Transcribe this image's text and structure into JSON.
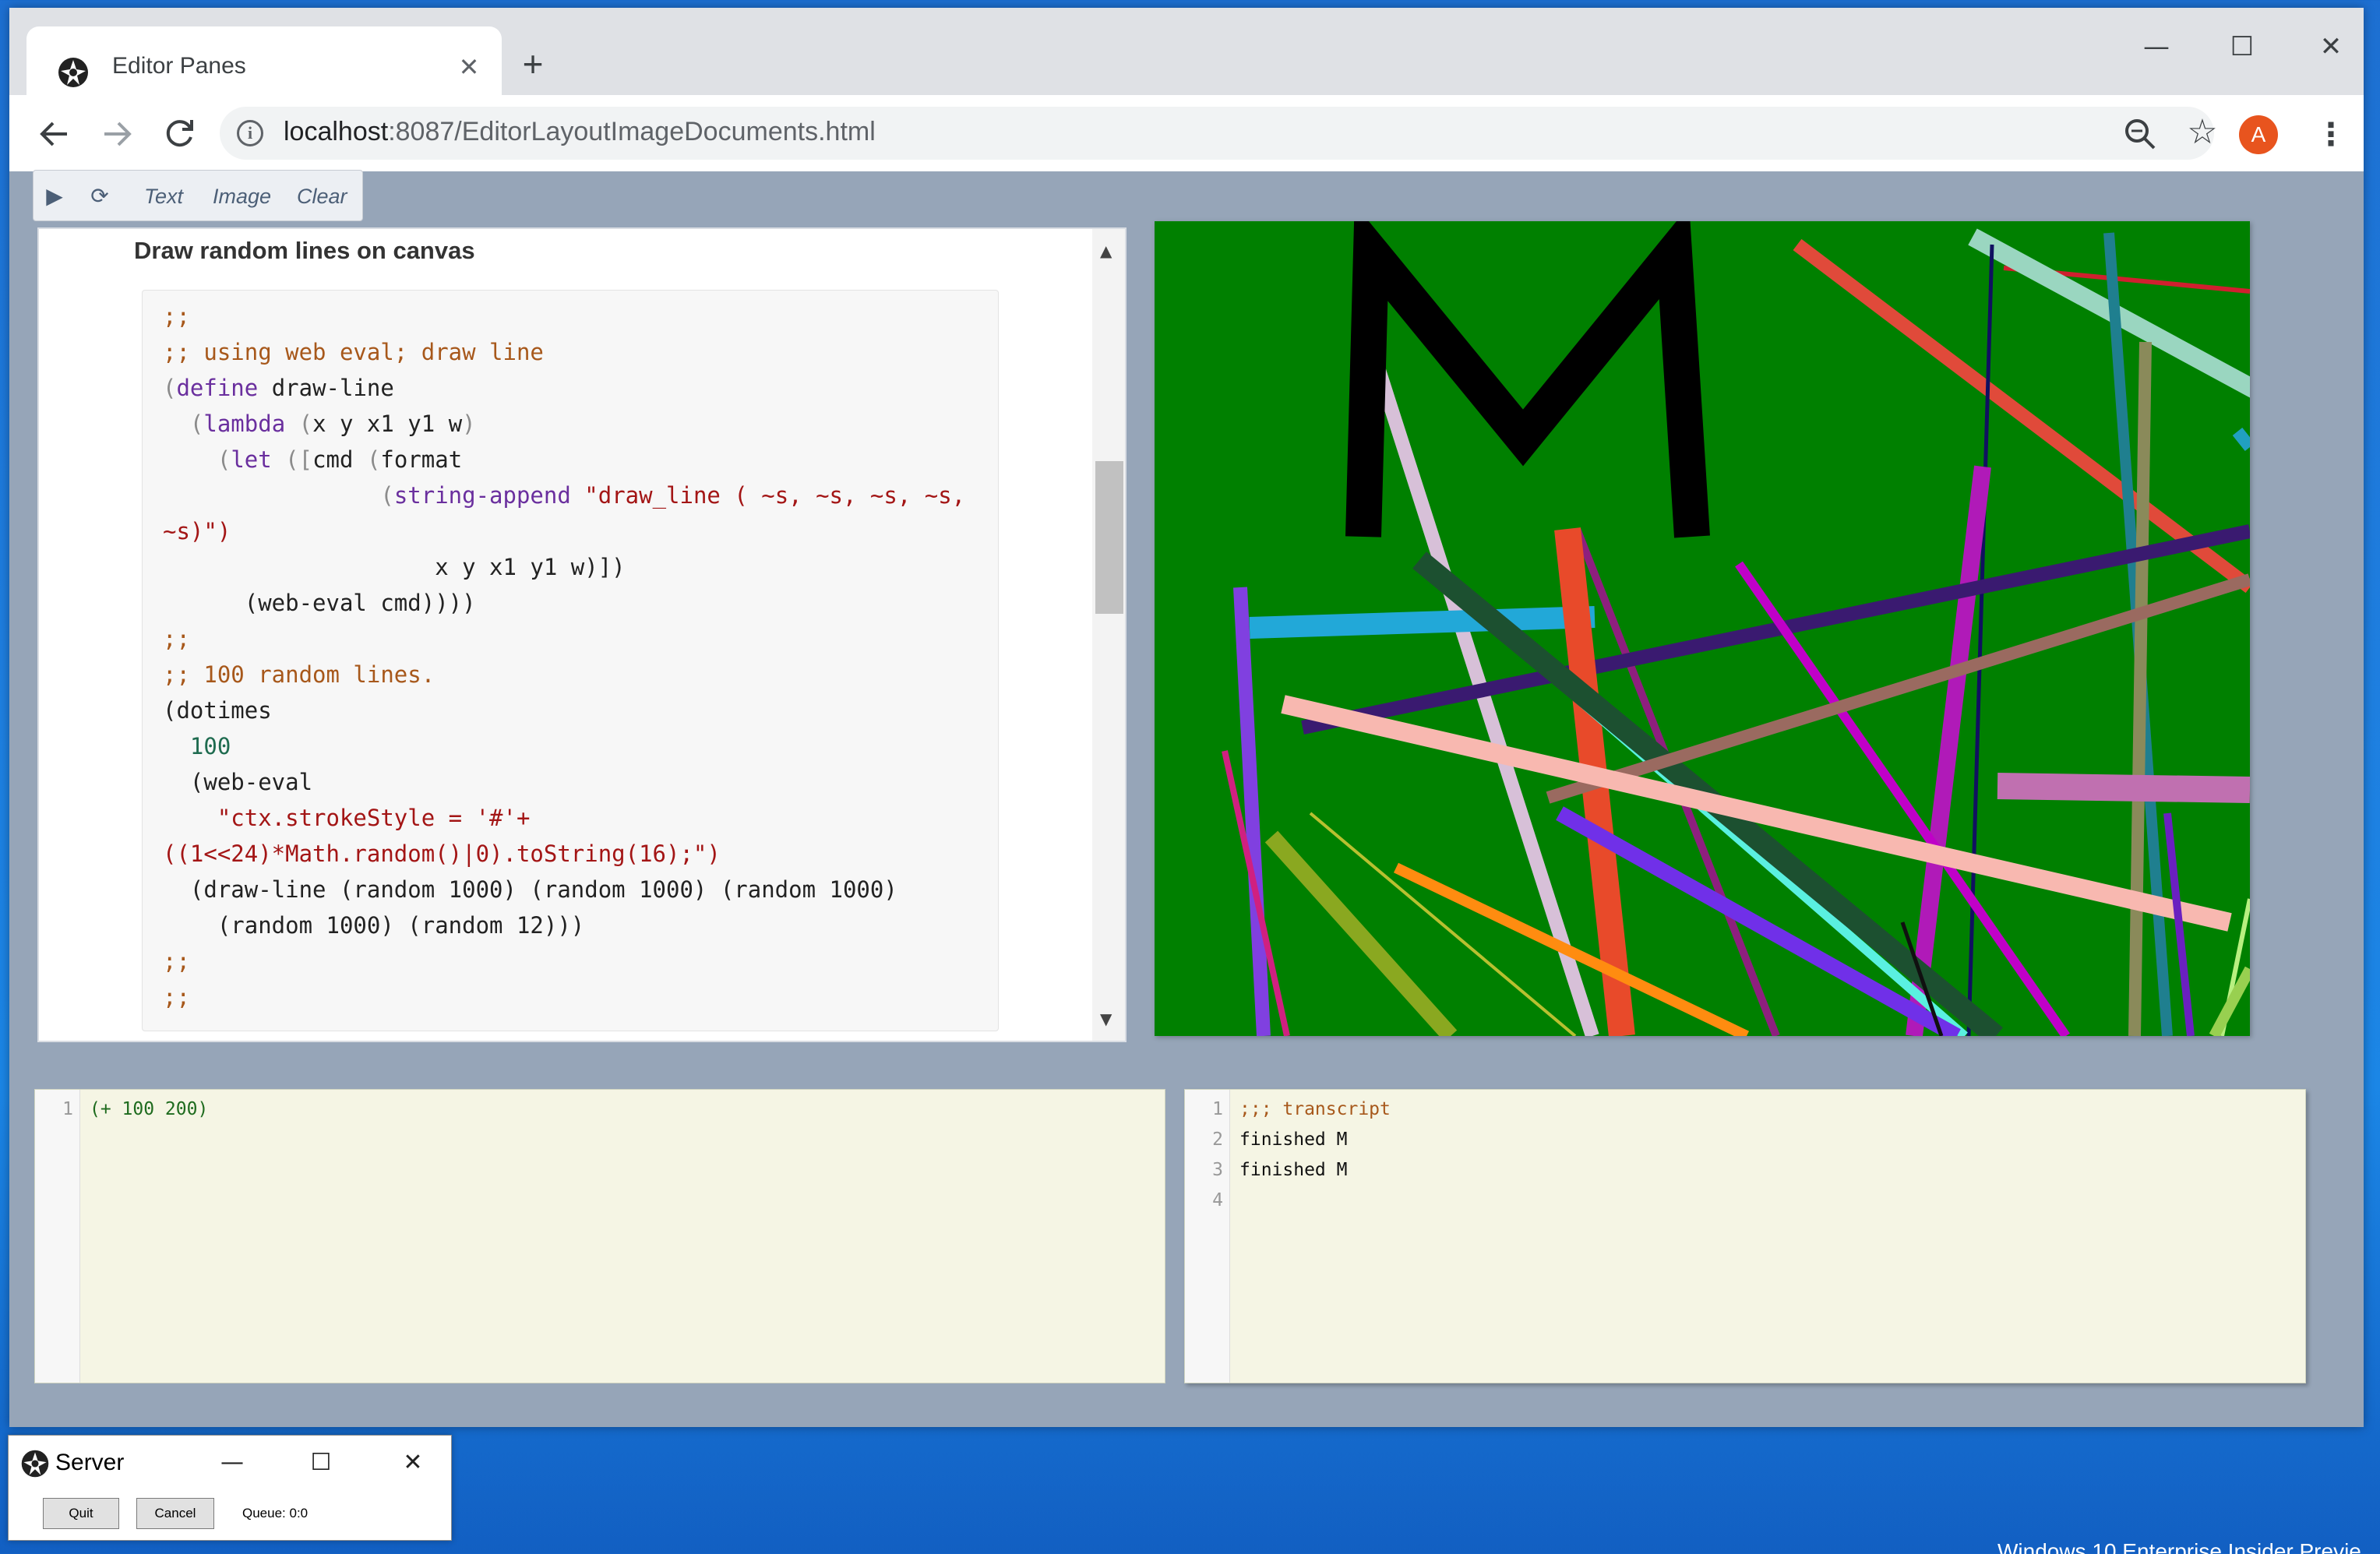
{
  "browser": {
    "tab_title": "Editor Panes",
    "tab_close": "✕",
    "new_tab": "+",
    "url_host": "localhost",
    "url_rest": ":8087/EditorLayoutImageDocuments.html",
    "avatar_letter": "A",
    "window_controls": [
      "—",
      "☐",
      "✕"
    ]
  },
  "page_toolbar": {
    "run_icon": "▶",
    "refresh_icon": "⟳",
    "text_label": "Text",
    "image_label": "Image",
    "clear_label": "Clear"
  },
  "document": {
    "heading": "Draw random lines on canvas",
    "code_lines": [
      ";;",
      ";; using web eval; draw line",
      "(define draw-line",
      "  (lambda (x y x1 y1 w)",
      "    (let ([cmd (format",
      "                (string-append \"draw_line ( ~s, ~s, ~s, ~s,",
      "~s)\")",
      "                    x y x1 y1 w)])",
      "      (web-eval cmd))))",
      ";;",
      ";; 100 random lines.",
      "(dotimes",
      "  100",
      "  (web-eval",
      "    \"ctx.strokeStyle = '#'+",
      "((1<<24)*Math.random()|0).toString(16);\")",
      "  (draw-line (random 1000) (random 1000) (random 1000)",
      "    (random 1000) (random 12)))",
      ";;",
      ";;"
    ]
  },
  "canvas": {
    "background": "#008000",
    "letter": "M"
  },
  "left_editor": {
    "line_numbers": [
      "1"
    ],
    "lines": [
      "(+ 100 200)"
    ]
  },
  "right_editor": {
    "line_numbers": [
      "1",
      "2",
      "3",
      "4"
    ],
    "lines": [
      ";;; transcript",
      "finished M",
      "finished M",
      ""
    ]
  },
  "server_window": {
    "title": "Server",
    "quit_label": "Quit",
    "cancel_label": "Cancel",
    "queue_text": "Queue: 0:0",
    "controls": [
      "—",
      "☐",
      "✕"
    ]
  },
  "desktop": {
    "watermark": "Windows 10 Enterprise Insider Previe"
  }
}
